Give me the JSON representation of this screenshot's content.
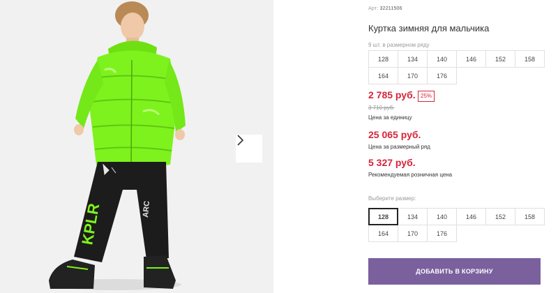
{
  "product": {
    "sku_label": "Арт:",
    "sku_value": "32211506",
    "title": "Куртка зимняя для мальчика",
    "pack_note": "9 шт. в размерном ряду",
    "pack_sizes": [
      "128",
      "134",
      "140",
      "146",
      "152",
      "158",
      "164",
      "170",
      "176"
    ],
    "price": "2 785 руб.",
    "discount_badge": "25%",
    "old_price": "3 710 руб.",
    "price_unit_label": "Цена за единицу",
    "pack_price": "25 065 руб.",
    "pack_price_label": "Цена за размерный ряд",
    "retail_price": "5 327 руб.",
    "retail_price_label": "Рекомендуемая розничная цена",
    "size_select_label": "Выберите размер:",
    "size_options": [
      "128",
      "134",
      "140",
      "146",
      "152",
      "158",
      "164",
      "170",
      "176"
    ],
    "selected_size": "128",
    "add_to_cart_label": "ДОБАВИТЬ В КОРЗИНУ"
  },
  "gallery": {
    "next_icon": "chevron-right-icon",
    "jacket_color": "#7ef21d",
    "pants_color": "#1c1c1c",
    "background_color": "#f1f1f1"
  },
  "colors": {
    "price_red": "#d6253a",
    "button_purple": "#7a619e"
  }
}
